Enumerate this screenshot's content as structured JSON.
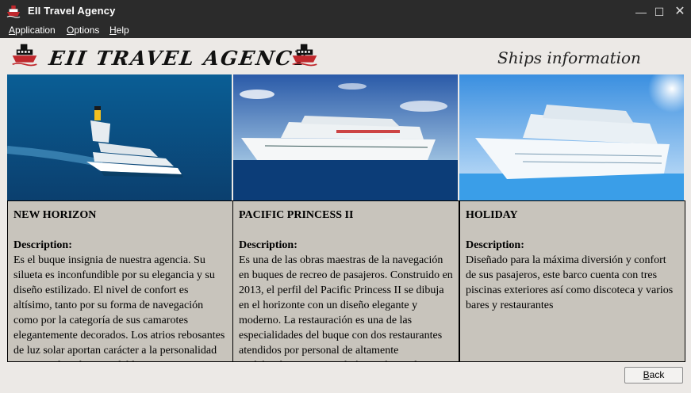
{
  "window": {
    "title": "EII Travel Agency",
    "controls": [
      "minimize-icon",
      "maximize-icon",
      "close-icon"
    ]
  },
  "menu": {
    "items": [
      {
        "label": "Application",
        "mnemonic": "A"
      },
      {
        "label": "Options",
        "mnemonic": "O"
      },
      {
        "label": "Help",
        "mnemonic": "H"
      }
    ]
  },
  "banner": {
    "brand": "EII TRAVEL AGENCY",
    "section_title": "Ships information"
  },
  "ships": [
    {
      "name": "NEW HORIZON",
      "description_label": "Description:",
      "description": "Es el buque insignia de nuestra agencia. Su silueta es inconfundible por su elegancia y su diseño estilizado. El nivel de confort es altísimo, tanto por su forma de navegación como por la categoría de sus camarotes elegantemente decorados. Los atrios rebosantes de luz solar aportan carácter a la personalidad propia y el estilo inigualable."
    },
    {
      "name": "PACIFIC PRINCESS II",
      "description_label": "Description:",
      "description": "Es una de las obras maestras de la navegación en buques de recreo de pasajeros. Construido en 2013, el perfil del Pacific Princess II se dibuja en el horizonte con un diseño elegante y moderno. La restauración es una de las especialidades del buque con dos restaurantes atendidos por personal de altamente cualificado. Cuenta también con bares de copas."
    },
    {
      "name": "HOLIDAY",
      "description_label": "Description:",
      "description": "Diseñado para la máxima diversión y confort de sus pasajeros, este barco cuenta con tres piscinas exteriores así como discoteca y varios bares y restaurantes"
    }
  ],
  "footer": {
    "back_label": "Back",
    "back_mnemonic": "B"
  }
}
